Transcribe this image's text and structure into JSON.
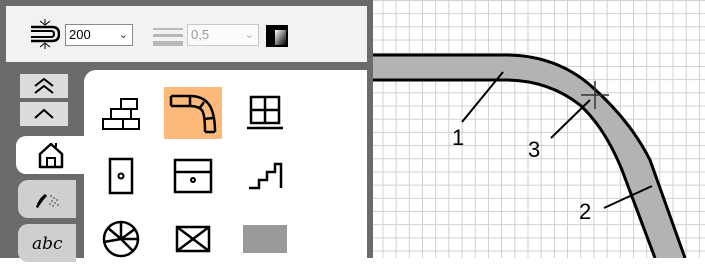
{
  "toolbar": {
    "wall_thickness_icon": "wall-thickness-icon",
    "wall_thickness_value": "200",
    "line_width_icon": "line-width-icon",
    "line_width_value": "0,5",
    "fill_icon": "fill-gradient-icon"
  },
  "sidebar": {
    "nav_up_fast": "double-chevron-up-icon",
    "nav_up": "chevron-up-icon",
    "tabs": [
      {
        "icon": "house-icon",
        "active": true
      },
      {
        "icon": "pen-spray-icon",
        "active": false
      },
      {
        "icon": "handwriting-text-icon",
        "active": false
      }
    ]
  },
  "palette": {
    "items": [
      {
        "icon": "brick-wall-icon",
        "selected": false
      },
      {
        "icon": "curved-wall-icon",
        "selected": true
      },
      {
        "icon": "window-icon",
        "selected": false
      },
      {
        "icon": "door-icon",
        "selected": false
      },
      {
        "icon": "cabinet-icon",
        "selected": false
      },
      {
        "icon": "stairs-icon",
        "selected": false
      },
      {
        "icon": "spiral-stairs-icon",
        "selected": false
      },
      {
        "icon": "opening-icon",
        "selected": false
      },
      {
        "icon": "gray-rectangle-icon",
        "selected": false
      }
    ]
  },
  "canvas": {
    "callouts": [
      "1",
      "2",
      "3"
    ],
    "colors": {
      "wall_fill": "#b3b3b3",
      "wall_stroke": "#000000",
      "grid": "#cfcfcf",
      "selected": "#fdb97a"
    }
  }
}
